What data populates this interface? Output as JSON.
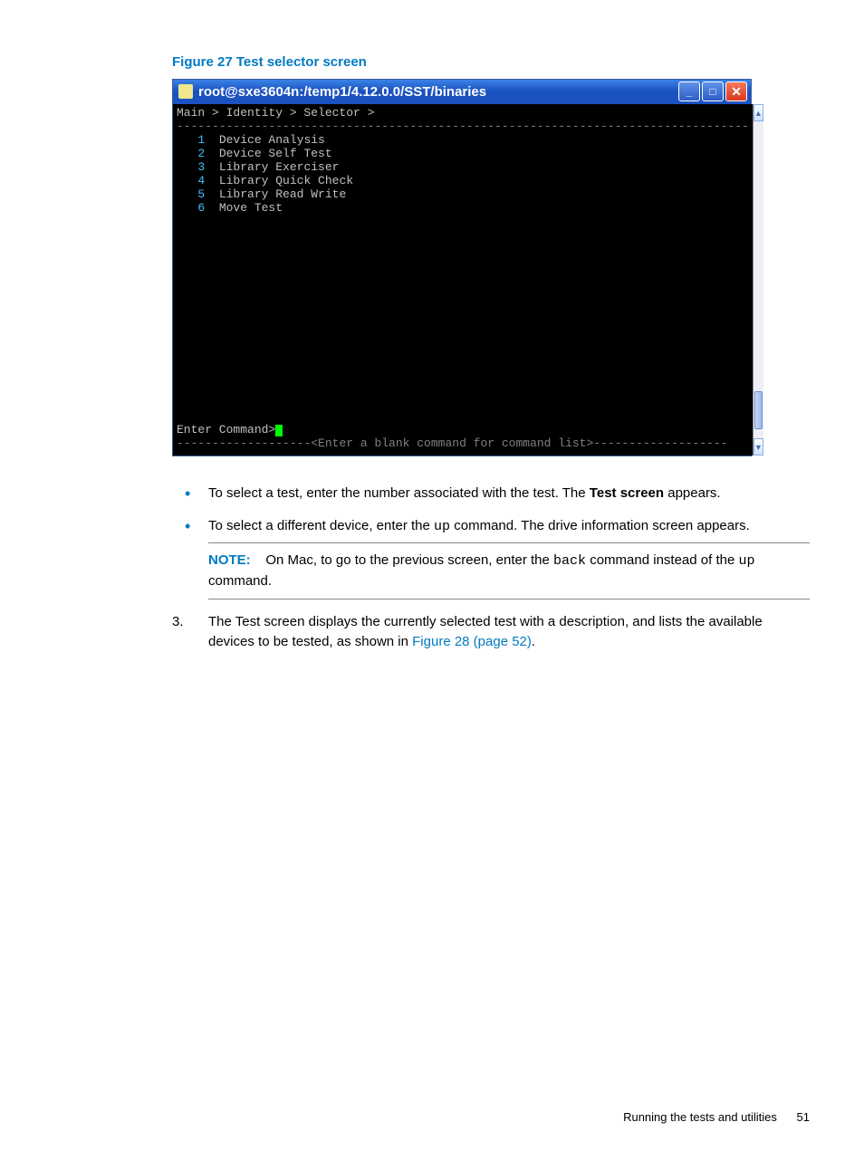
{
  "figure_caption": "Figure 27 Test selector screen",
  "window": {
    "title": "root@sxe3604n:/temp1/4.12.0.0/SST/binaries",
    "breadcrumb": "Main > Identity > Selector >",
    "divider_top": "---------------------------------------------------------------------------------",
    "menu": [
      {
        "num": "1",
        "label": "Device Analysis"
      },
      {
        "num": "2",
        "label": "Device Self Test"
      },
      {
        "num": "3",
        "label": "Library Exerciser"
      },
      {
        "num": "4",
        "label": "Library Quick Check"
      },
      {
        "num": "5",
        "label": "Library Read Write"
      },
      {
        "num": "6",
        "label": "Move Test"
      }
    ],
    "prompt": "Enter Command>",
    "hint_left": "------------------",
    "hint_mid": "-<Enter a blank command for command list>-",
    "hint_right": "------------------"
  },
  "bullets": {
    "b1_pre": "To select a test, enter the number associated with the test. The ",
    "b1_bold": "Test screen",
    "b1_post": " appears.",
    "b2_pre": "To select a different device, enter the ",
    "b2_code": "up",
    "b2_post": " command. The drive information screen appears."
  },
  "note": {
    "label": "NOTE:",
    "pre": "On Mac, to go to the previous screen, enter the ",
    "code1": "back",
    "mid": " command instead of the ",
    "code2": "up",
    "post": " command."
  },
  "step3": {
    "num": "3.",
    "pre": "The Test screen displays the currently selected test with a description, and lists the available devices to be tested, as shown in ",
    "link": "Figure 28 (page 52)",
    "post": "."
  },
  "footer": {
    "text": "Running the tests and utilities",
    "page": "51"
  }
}
